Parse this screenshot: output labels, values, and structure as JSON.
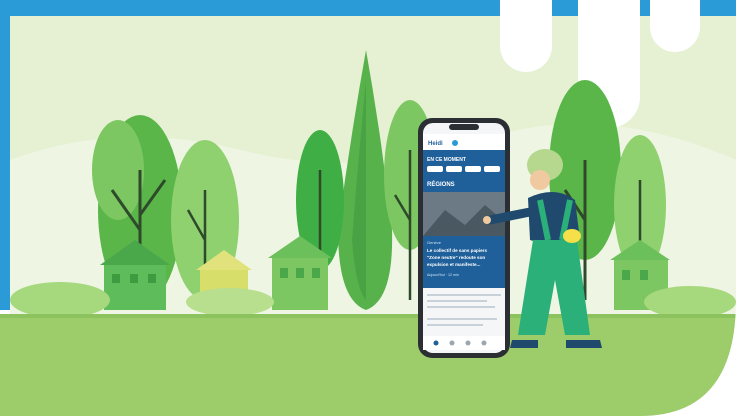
{
  "colors": {
    "frame": "#2a9bd6",
    "sky": "#e6f1d4",
    "ground": "#9ccd6a",
    "phone_header": "#1f5f9a",
    "phone_body": "#f4f6f8"
  },
  "phone": {
    "logo": "Heidi",
    "section_header": "EN CE MOMENT",
    "chips": [
      "",
      "",
      "",
      ""
    ],
    "region_title": "RÉGIONS",
    "article": {
      "kicker": "Genève",
      "headline_lines": [
        "Le collectif de sans papiers",
        "\"Zone neutre\" redoute son",
        "expulsion et manifeste..."
      ],
      "meta": "Aujourd'hui · 12 min"
    }
  },
  "icons": [
    "phone-icon",
    "tree-icon",
    "house-icon",
    "person-icon",
    "bag-icon"
  ]
}
